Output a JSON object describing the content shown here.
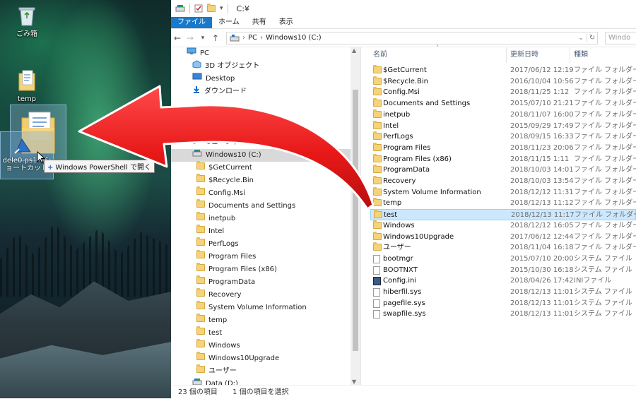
{
  "desktop": {
    "recycle_bin_label": "ごみ箱",
    "temp_label": "temp",
    "shortcut_label": "dele0.ps1 - ショートカット",
    "drag_tooltip": "Windows PowerShell で開く",
    "drag_tooltip_plus": "+"
  },
  "window": {
    "title": "C:¥",
    "ribbon_tabs": [
      "ファイル",
      "ホーム",
      "共有",
      "表示"
    ]
  },
  "address": {
    "crumbs": [
      "PC",
      "Windows10 (C:)"
    ],
    "search_placeholder": "Windo"
  },
  "nav": {
    "items": [
      {
        "label": "PC",
        "indent": 0,
        "icon": "pc-icon"
      },
      {
        "label": "3D オブジェクト",
        "indent": 1,
        "icon": "3d-objects-icon"
      },
      {
        "label": "Desktop",
        "indent": 1,
        "icon": "desktop-icon"
      },
      {
        "label": "ダウンロード",
        "indent": 1,
        "icon": "download-icon"
      },
      {
        "label": "",
        "indent": 1,
        "icon": "hidden"
      },
      {
        "label": "",
        "indent": 1,
        "icon": "hidden"
      },
      {
        "label": "ビデオ",
        "indent": 1,
        "icon": "video-icon"
      },
      {
        "label": "ミュージック",
        "indent": 1,
        "icon": "music-icon"
      },
      {
        "label": "Windows10 (C:)",
        "indent": 1,
        "icon": "drive-icon",
        "selected": true
      },
      {
        "label": "$GetCurrent",
        "indent": 2,
        "icon": "folder-icon"
      },
      {
        "label": "$Recycle.Bin",
        "indent": 2,
        "icon": "folder-icon"
      },
      {
        "label": "Config.Msi",
        "indent": 2,
        "icon": "folder-icon"
      },
      {
        "label": "Documents and Settings",
        "indent": 2,
        "icon": "shortcut-folder-icon"
      },
      {
        "label": "inetpub",
        "indent": 2,
        "icon": "folder-icon"
      },
      {
        "label": "Intel",
        "indent": 2,
        "icon": "folder-icon"
      },
      {
        "label": "PerfLogs",
        "indent": 2,
        "icon": "folder-icon"
      },
      {
        "label": "Program Files",
        "indent": 2,
        "icon": "folder-icon"
      },
      {
        "label": "Program Files (x86)",
        "indent": 2,
        "icon": "folder-icon"
      },
      {
        "label": "ProgramData",
        "indent": 2,
        "icon": "folder-icon"
      },
      {
        "label": "Recovery",
        "indent": 2,
        "icon": "folder-icon"
      },
      {
        "label": "System Volume Information",
        "indent": 2,
        "icon": "folder-icon"
      },
      {
        "label": "temp",
        "indent": 2,
        "icon": "folder-icon"
      },
      {
        "label": "test",
        "indent": 2,
        "icon": "folder-icon"
      },
      {
        "label": "Windows",
        "indent": 2,
        "icon": "folder-icon"
      },
      {
        "label": "Windows10Upgrade",
        "indent": 2,
        "icon": "folder-icon"
      },
      {
        "label": "ユーザー",
        "indent": 2,
        "icon": "folder-icon"
      },
      {
        "label": "Data (D:)",
        "indent": 1,
        "icon": "drive-icon"
      }
    ]
  },
  "files": {
    "columns": [
      "名前",
      "更新日時",
      "種類"
    ],
    "rows": [
      {
        "name": "$GetCurrent",
        "date": "2017/06/12 12:19",
        "type": "ファイル フォルダー",
        "icon": "folder-icon"
      },
      {
        "name": "$Recycle.Bin",
        "date": "2016/10/04 10:56",
        "type": "ファイル フォルダー",
        "icon": "folder-icon"
      },
      {
        "name": "Config.Msi",
        "date": "2018/11/25 1:12",
        "type": "ファイル フォルダー",
        "icon": "folder-icon"
      },
      {
        "name": "Documents and Settings",
        "date": "2015/07/10 21:21",
        "type": "ファイル フォルダー",
        "icon": "shortcut-folder-icon"
      },
      {
        "name": "inetpub",
        "date": "2018/11/07 16:00",
        "type": "ファイル フォルダー",
        "icon": "folder-icon"
      },
      {
        "name": "Intel",
        "date": "2015/09/29 17:49",
        "type": "ファイル フォルダー",
        "icon": "folder-icon"
      },
      {
        "name": "PerfLogs",
        "date": "2018/09/15 16:33",
        "type": "ファイル フォルダー",
        "icon": "folder-icon"
      },
      {
        "name": "Program Files",
        "date": "2018/11/23 20:06",
        "type": "ファイル フォルダー",
        "icon": "folder-icon"
      },
      {
        "name": "Program Files (x86)",
        "date": "2018/11/15 1:11",
        "type": "ファイル フォルダー",
        "icon": "folder-icon"
      },
      {
        "name": "ProgramData",
        "date": "2018/10/03 14:01",
        "type": "ファイル フォルダー",
        "icon": "folder-icon"
      },
      {
        "name": "Recovery",
        "date": "2018/10/03 13:54",
        "type": "ファイル フォルダー",
        "icon": "folder-icon"
      },
      {
        "name": "System Volume Information",
        "date": "2018/12/12 11:31",
        "type": "ファイル フォルダー",
        "icon": "folder-icon"
      },
      {
        "name": "temp",
        "date": "2018/12/13 11:12",
        "type": "ファイル フォルダー",
        "icon": "folder-icon"
      },
      {
        "name": "test",
        "date": "2018/12/13 11:17",
        "type": "ファイル フォルダー",
        "icon": "folder-icon",
        "selected": true
      },
      {
        "name": "Windows",
        "date": "2018/12/12 16:05",
        "type": "ファイル フォルダー",
        "icon": "folder-icon"
      },
      {
        "name": "Windows10Upgrade",
        "date": "2017/06/12 12:44",
        "type": "ファイル フォルダー",
        "icon": "folder-icon"
      },
      {
        "name": "ユーザー",
        "date": "2018/11/04 16:18",
        "type": "ファイル フォルダー",
        "icon": "folder-icon"
      },
      {
        "name": "bootmgr",
        "date": "2015/07/10 20:00",
        "type": "システム ファイル",
        "icon": "file-icon"
      },
      {
        "name": "BOOTNXT",
        "date": "2015/10/30 16:18",
        "type": "システム ファイル",
        "icon": "file-icon"
      },
      {
        "name": "Config.ini",
        "date": "2018/04/26 17:42",
        "type": "INIファイル",
        "icon": "ini-icon"
      },
      {
        "name": "hiberfil.sys",
        "date": "2018/12/13 11:01",
        "type": "システム ファイル",
        "icon": "file-icon"
      },
      {
        "name": "pagefile.sys",
        "date": "2018/12/13 11:01",
        "type": "システム ファイル",
        "icon": "file-icon"
      },
      {
        "name": "swapfile.sys",
        "date": "2018/12/13 11:01",
        "type": "システム ファイル",
        "icon": "file-icon"
      }
    ]
  },
  "status": {
    "item_count": "23 個の項目",
    "selected_count": "1 個の項目を選択"
  },
  "colors": {
    "file_tab": "#1979ca",
    "selection": "#cce8ff",
    "arrow_red": "#e81818"
  }
}
